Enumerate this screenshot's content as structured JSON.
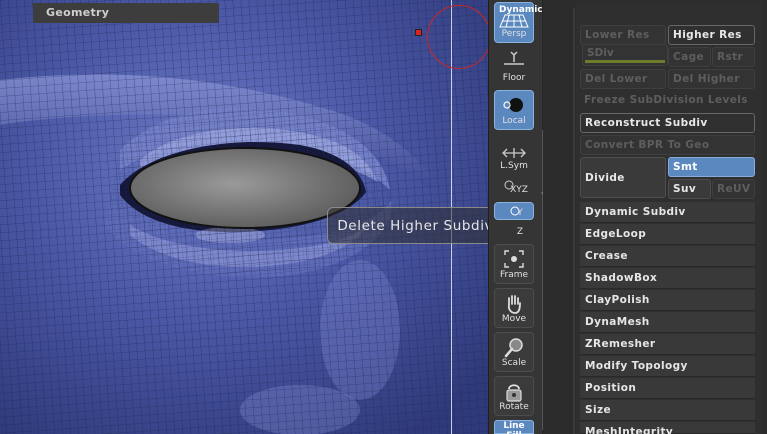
{
  "viewport": {
    "tooltip": "Delete Higher Subdiv Level"
  },
  "shelf": {
    "buttons": [
      {
        "id": "persp",
        "top_label": "Dynamic",
        "label": "Persp",
        "active": true
      },
      {
        "id": "floor",
        "label": "Floor",
        "active": false
      },
      {
        "id": "local",
        "label": "Local",
        "active": true
      },
      {
        "id": "lsym",
        "label": "L.Sym",
        "active": false
      },
      {
        "id": "xyz",
        "label": "XYZ",
        "active": false
      },
      {
        "id": "y",
        "label": "Y",
        "active": true
      },
      {
        "id": "z",
        "label": "Z",
        "active": false
      },
      {
        "id": "frame",
        "label": "Frame",
        "active": false
      },
      {
        "id": "move",
        "label": "Move",
        "active": false
      },
      {
        "id": "scale",
        "label": "Scale",
        "active": false
      },
      {
        "id": "rotate",
        "label": "Rotate",
        "active": false
      },
      {
        "id": "linefill",
        "label": "Line Fill",
        "active": true
      }
    ]
  },
  "palette": {
    "title": "Geometry",
    "lower_res": "Lower Res",
    "higher_res": "Higher Res",
    "sdiv_label": "SDiv",
    "sdiv_fill_fraction": 1.0,
    "cage": "Cage",
    "rstr": "Rstr",
    "del_lower": "Del Lower",
    "del_higher": "Del Higher",
    "freeze_subdivision_levels": "Freeze SubDivision Levels",
    "reconstruct_subdiv": "Reconstruct Subdiv",
    "convert_bpr_to_geo": "Convert BPR To Geo",
    "divide": "Divide",
    "smt": "Smt",
    "suv": "Suv",
    "reuv": "ReUV",
    "sections": [
      "Dynamic Subdiv",
      "EdgeLoop",
      "Crease",
      "ShadowBox",
      "ClayPolish",
      "DynaMesh",
      "ZRemesher",
      "Modify Topology",
      "Position",
      "Size",
      "MeshIntegrity"
    ]
  },
  "colors": {
    "accent_blue": "#5b88bf",
    "mesh_blue": "#4c5aa8",
    "sdiv_fill": "#6b7d2a"
  }
}
